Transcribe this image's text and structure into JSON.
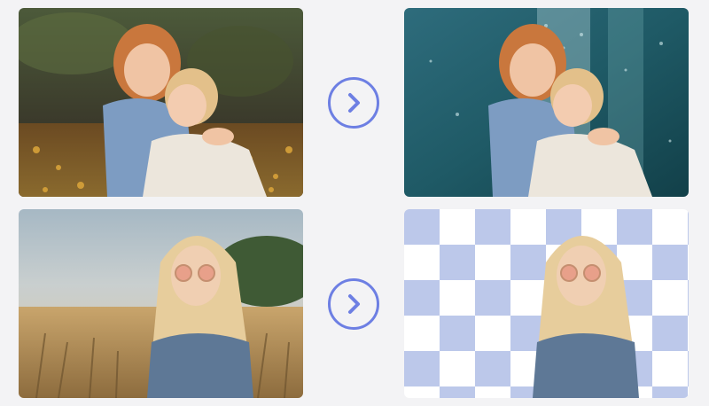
{
  "colors": {
    "page_background": "#f3f3f5",
    "accent": "#6d7fe3",
    "checker_light": "#ffffff",
    "checker_dark": "#bcc8ea"
  },
  "examples": [
    {
      "label": "",
      "before_image": "photo-two-girls-hugging-autumn-leaves",
      "action_icon": "chevron-right-icon",
      "after_image": "photo-two-girls-hugging-rainy-window-background"
    },
    {
      "label": "",
      "before_image": "photo-woman-sunglasses-wheat-field",
      "action_icon": "chevron-right-icon",
      "after_image": "photo-woman-sunglasses-transparent-background"
    }
  ]
}
